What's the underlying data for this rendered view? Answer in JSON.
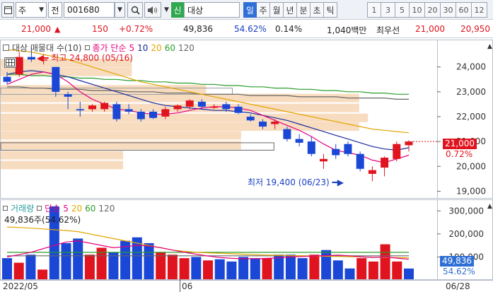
{
  "toolbar": {
    "market_label": "주",
    "code_label": "전",
    "stock_code": "001680",
    "sin_label": "신",
    "stock_name": "대상",
    "period_tabs": [
      "일",
      "주",
      "월",
      "년",
      "분",
      "초",
      "틱"
    ],
    "active_period": "일",
    "interval_buttons": [
      "1",
      "3",
      "5",
      "10",
      "20",
      "30",
      "60",
      "12"
    ]
  },
  "quote": {
    "price": "21,000",
    "change": "150",
    "change_pct": "+0.72%",
    "volume": "49,836",
    "volume_ratio": "54.62%",
    "turnover_pct": "0.14%",
    "amount": "1,040백만",
    "best_bid_label": "최우선",
    "best_bid": "21,000",
    "best_ask": "20,950"
  },
  "price_panel": {
    "legend_prefix": "대상 매물대 수(10)",
    "legend_close": "종가 단순",
    "ma_periods": [
      "5",
      "10",
      "20",
      "60",
      "120"
    ],
    "high_annotation": "최고 24,800 (05/16)",
    "low_annotation": "최저 19,400 (06/23)",
    "current_tag": "21,000",
    "current_pct": "0.72%"
  },
  "volume_panel": {
    "legend_title": "거래량",
    "legend_ma": "단순",
    "ma_periods": [
      "5",
      "20",
      "60",
      "120"
    ],
    "current_line": "49,836주(54.62%)",
    "current_tag": "49,836",
    "current_pct": "54.62%"
  },
  "x_axis": {
    "labels": [
      "2022/05",
      "06",
      "06/28"
    ]
  },
  "colors": {
    "up": "#e0141e",
    "down": "#1a47d6",
    "ma5": "#e6007e",
    "ma10": "#1a2a9c",
    "ma20": "#e3a500",
    "ma60": "#2a9d2a",
    "ma120": "#666666",
    "volume_profile": "#f7dcc0"
  },
  "chart_data": {
    "type": "candlestick",
    "price_axis": {
      "ylim": [
        18700,
        25100
      ],
      "ticks": [
        19000,
        20000,
        21000,
        22000,
        23000,
        24000
      ]
    },
    "candles": [
      {
        "o": 23600,
        "h": 23800,
        "l": 23300,
        "c": 23400
      },
      {
        "o": 23700,
        "h": 24600,
        "l": 23600,
        "c": 24400
      },
      {
        "o": 24400,
        "h": 24800,
        "l": 24200,
        "c": 24300
      },
      {
        "o": 24300,
        "h": 24500,
        "l": 24100,
        "c": 24300
      },
      {
        "o": 24000,
        "h": 24000,
        "l": 22800,
        "c": 23000
      },
      {
        "o": 22900,
        "h": 23000,
        "l": 22300,
        "c": 22800
      },
      {
        "o": 22300,
        "h": 22600,
        "l": 22000,
        "c": 22250
      },
      {
        "o": 22300,
        "h": 22500,
        "l": 22200,
        "c": 22450
      },
      {
        "o": 22300,
        "h": 22600,
        "l": 22200,
        "c": 22550
      },
      {
        "o": 22500,
        "h": 22600,
        "l": 21800,
        "c": 21900
      },
      {
        "o": 22300,
        "h": 22500,
        "l": 22100,
        "c": 22200
      },
      {
        "o": 22200,
        "h": 22300,
        "l": 21800,
        "c": 21900
      },
      {
        "o": 22200,
        "h": 22300,
        "l": 21900,
        "c": 21950
      },
      {
        "o": 22000,
        "h": 22400,
        "l": 21900,
        "c": 22300
      },
      {
        "o": 22300,
        "h": 22500,
        "l": 22200,
        "c": 22450
      },
      {
        "o": 22400,
        "h": 22700,
        "l": 22300,
        "c": 22650
      },
      {
        "o": 22600,
        "h": 22700,
        "l": 22300,
        "c": 22400
      },
      {
        "o": 22400,
        "h": 22500,
        "l": 22300,
        "c": 22400
      },
      {
        "o": 22500,
        "h": 22600,
        "l": 22200,
        "c": 22300
      },
      {
        "o": 22400,
        "h": 22500,
        "l": 22100,
        "c": 22150
      },
      {
        "o": 22000,
        "h": 22100,
        "l": 21800,
        "c": 21850
      },
      {
        "o": 21800,
        "h": 21900,
        "l": 21500,
        "c": 21600
      },
      {
        "o": 21700,
        "h": 21900,
        "l": 21500,
        "c": 21800
      },
      {
        "o": 21500,
        "h": 21600,
        "l": 21000,
        "c": 21100
      },
      {
        "o": 21100,
        "h": 21300,
        "l": 20800,
        "c": 20950
      },
      {
        "o": 21000,
        "h": 21200,
        "l": 20400,
        "c": 20500
      },
      {
        "o": 20200,
        "h": 20500,
        "l": 19900,
        "c": 20300
      },
      {
        "o": 20700,
        "h": 20900,
        "l": 20300,
        "c": 20450
      },
      {
        "o": 20900,
        "h": 21000,
        "l": 20400,
        "c": 20500
      },
      {
        "o": 20500,
        "h": 20600,
        "l": 19800,
        "c": 19900
      },
      {
        "o": 19700,
        "h": 20000,
        "l": 19400,
        "c": 19850
      },
      {
        "o": 19950,
        "h": 20400,
        "l": 19600,
        "c": 20350
      },
      {
        "o": 20300,
        "h": 21000,
        "l": 20200,
        "c": 20900
      },
      {
        "o": 20850,
        "h": 21050,
        "l": 20600,
        "c": 21000
      }
    ],
    "ma_lines": {
      "ma5": [
        23300,
        23500,
        23700,
        23800,
        23700,
        23400,
        23000,
        22700,
        22500,
        22300,
        22250,
        22150,
        22100,
        22100,
        22150,
        22250,
        22350,
        22400,
        22400,
        22350,
        22250,
        22050,
        21850,
        21650,
        21450,
        21200,
        20900,
        20650,
        20550,
        20450,
        20250,
        20150,
        20300,
        20450
      ],
      "ma10": [
        23700,
        23800,
        23850,
        23800,
        23700,
        23600,
        23450,
        23300,
        23150,
        23000,
        22850,
        22700,
        22550,
        22450,
        22400,
        22350,
        22300,
        22250,
        22250,
        22200,
        22150,
        22050,
        21950,
        21850,
        21700,
        21550,
        21400,
        21250,
        21100,
        20950,
        20800,
        20700,
        20650,
        20750
      ],
      "ma20": [
        24700,
        24650,
        24600,
        24500,
        24400,
        24300,
        24150,
        24000,
        23850,
        23700,
        23550,
        23400,
        23300,
        23200,
        23100,
        23000,
        22900,
        22800,
        22700,
        22600,
        22500,
        22400,
        22300,
        22200,
        22100,
        22000,
        21900,
        21800,
        21700,
        21600,
        21500,
        21450,
        21400,
        21350
      ],
      "ma60": [
        23700,
        23700,
        23650,
        23650,
        23600,
        23600,
        23550,
        23550,
        23500,
        23500,
        23450,
        23450,
        23400,
        23400,
        23350,
        23350,
        23300,
        23300,
        23250,
        23250,
        23200,
        23200,
        23150,
        23150,
        23100,
        23100,
        23050,
        23050,
        23000,
        23000,
        22950,
        22950,
        22900,
        22900
      ],
      "ma120": [
        23200,
        23200,
        23150,
        23150,
        23100,
        23100,
        23100,
        23050,
        23050,
        23050,
        23000,
        23000,
        23000,
        22950,
        22950,
        22950,
        22900,
        22900,
        22900,
        22900,
        22850,
        22850,
        22850,
        22850,
        22800,
        22800,
        22800,
        22800,
        22750,
        22750,
        22750,
        22750,
        22700,
        22700
      ]
    },
    "volume_profile": [
      {
        "price": 24150,
        "width": 0.3
      },
      {
        "price": 23800,
        "width": 0.3
      },
      {
        "price": 23100,
        "width": 0.47
      },
      {
        "price": 22750,
        "width": 0.82
      },
      {
        "price": 22350,
        "width": 0.82
      },
      {
        "price": 21950,
        "width": 0.84
      },
      {
        "price": 21600,
        "width": 0.82
      },
      {
        "price": 21250,
        "width": 0.55
      },
      {
        "price": 20850,
        "width": 0.55
      },
      {
        "price": 20450,
        "width": 0.28
      },
      {
        "price": 20050,
        "width": 0.28
      }
    ],
    "volume_axis": {
      "ylim": [
        0,
        350000
      ],
      "ticks": [
        100000,
        200000,
        300000
      ]
    },
    "volumes": [
      95000,
      75000,
      110000,
      45000,
      320000,
      160000,
      180000,
      110000,
      140000,
      120000,
      170000,
      185000,
      160000,
      120000,
      110000,
      95000,
      100000,
      85000,
      90000,
      80000,
      100000,
      95000,
      95000,
      110000,
      110000,
      95000,
      110000,
      130000,
      85000,
      50000,
      95000,
      80000,
      155000,
      80000,
      49836
    ],
    "volume_ma5": [
      100000,
      110000,
      120000,
      135000,
      150000,
      165000,
      170000,
      160000,
      150000,
      140000,
      145000,
      150000,
      148000,
      140000,
      130000,
      120000,
      112000,
      104000,
      98000,
      94000,
      92000,
      92000,
      94000,
      96000,
      100000,
      102000,
      104000,
      106000,
      108000,
      105000,
      100000,
      98000,
      100000,
      95000,
      90000
    ],
    "volume_ma20": [
      230000,
      228000,
      225000,
      222000,
      218000,
      215000,
      210000,
      200000,
      190000,
      180000,
      170000,
      160000,
      150000,
      140000,
      130000,
      125000,
      120000,
      118000,
      116000,
      114000,
      112000,
      110000,
      108000,
      107000,
      106000,
      105000,
      104000,
      103000,
      102000,
      101000,
      100000,
      99000,
      98000,
      97000,
      96000
    ],
    "volume_ma60": [
      120000,
      120000,
      120000,
      120000,
      120000,
      120000,
      120000,
      120000,
      120000,
      120000,
      120000,
      120000,
      120000,
      120000,
      120000,
      120000,
      120000,
      120000,
      120000,
      120000,
      120000,
      120000,
      120000,
      120000,
      120000,
      120000,
      120000,
      120000,
      120000,
      120000,
      120000,
      120000,
      120000,
      120000,
      120000
    ],
    "volume_ma120": [
      105000,
      105000,
      105000,
      105000,
      105000,
      105000,
      105000,
      105000,
      105000,
      105000,
      105000,
      105000,
      105000,
      105000,
      105000,
      105000,
      105000,
      105000,
      105000,
      105000,
      105000,
      105000,
      105000,
      105000,
      105000,
      105000,
      105000,
      105000,
      105000,
      105000,
      105000,
      105000,
      105000,
      105000,
      105000
    ]
  }
}
